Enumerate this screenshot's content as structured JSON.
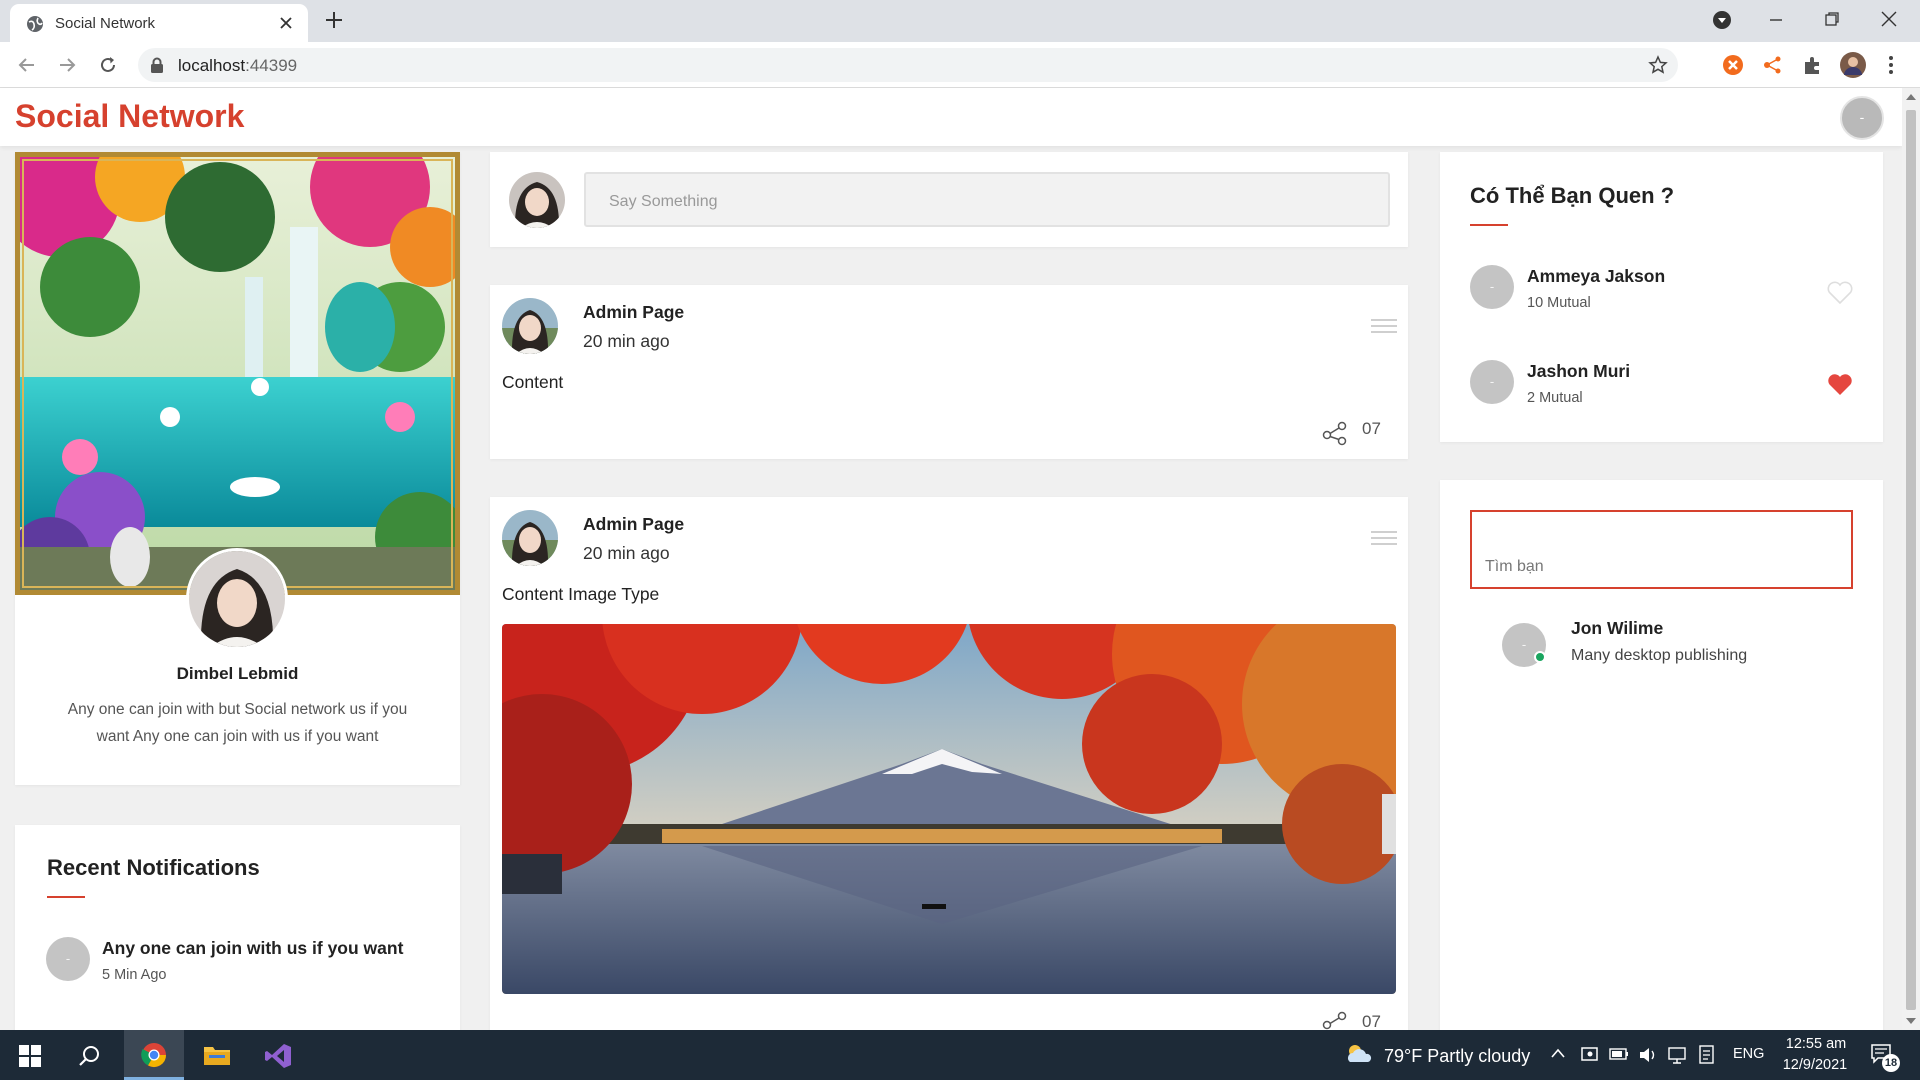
{
  "browser": {
    "tab_title": "Social Network",
    "url_host": "localhost",
    "url_port": ":44399"
  },
  "app": {
    "brand": "Social Network",
    "nav_avatar_text": "-"
  },
  "profile": {
    "name": "Dimbel Lebmid",
    "bio": "Any one can join with but Social network us if you want Any one can join with us if you want"
  },
  "notifications": {
    "title": "Recent Notifications",
    "items": [
      {
        "avatar_text": "-",
        "text": "Any one can join with us if you want",
        "time": "5 Min Ago"
      }
    ]
  },
  "compose": {
    "placeholder": "Say Something"
  },
  "posts": [
    {
      "author": "Admin Page",
      "time": "20 min ago",
      "content": "Content",
      "shares": "07"
    },
    {
      "author": "Admin Page",
      "time": "20 min ago",
      "content": "Content Image Type",
      "shares": "07"
    }
  ],
  "suggestions": {
    "title": "Có Thể Bạn Quen ?",
    "items": [
      {
        "avatar_text": "-",
        "name": "Ammeya Jakson",
        "mutual": "10 Mutual",
        "liked": false
      },
      {
        "avatar_text": "-",
        "name": "Jashon Muri",
        "mutual": "2 Mutual",
        "liked": true
      }
    ]
  },
  "friend_search": {
    "placeholder": "Tìm bạn",
    "results": [
      {
        "avatar_text": "-",
        "name": "Jon Wilime",
        "subtitle": "Many desktop publishing",
        "online": true
      }
    ]
  },
  "taskbar": {
    "weather": "79°F  Partly cloudy",
    "language": "ENG",
    "time": "12:55 am",
    "date": "12/9/2021",
    "notification_count": "18"
  },
  "colors": {
    "brand": "#d6412e",
    "heart": "#e5473f",
    "online": "#1aa55f"
  }
}
